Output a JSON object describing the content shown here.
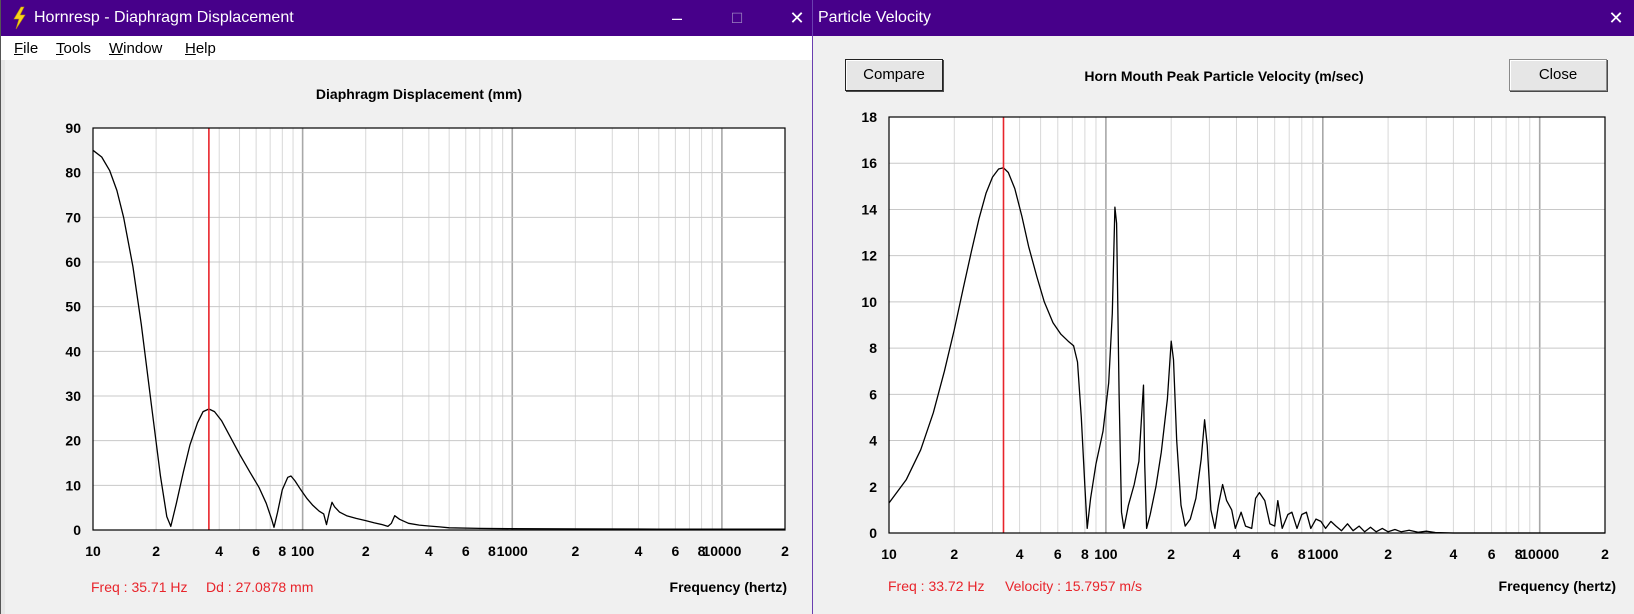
{
  "left_window": {
    "title": "Hornresp - Diaphragm Displacement",
    "icon": "lightning-bolt-icon",
    "menu": [
      {
        "label": "File",
        "accel": "F",
        "rest": "ile"
      },
      {
        "label": "Tools",
        "accel": "T",
        "rest": "ools"
      },
      {
        "label": "Window",
        "accel": "W",
        "rest": "indow"
      },
      {
        "label": "Help",
        "accel": "H",
        "rest": "elp"
      }
    ],
    "minimize_glyph": "–",
    "maximize_glyph": "☐",
    "close_glyph": "✕",
    "chart_title": "Diaphragm Displacement (mm)",
    "x_axis_label": "Frequency (hertz)",
    "readout_freq": "Freq : 35.71 Hz",
    "readout_value": "Dd : 27.0878 mm"
  },
  "right_window": {
    "title": "Particle Velocity",
    "close_glyph": "✕",
    "compare_button": "Compare",
    "close_button": "Close",
    "chart_title": "Horn Mouth Peak Particle Velocity (m/sec)",
    "x_axis_label": "Frequency (hertz)",
    "readout_freq": "Freq : 33.72 Hz",
    "readout_value": "Velocity : 15.7957 m/s"
  },
  "colors": {
    "titlebar": "#47008a",
    "marker": "#e8242b",
    "trace": "#000000",
    "grid": "#c8c8c8"
  },
  "chart_data": [
    {
      "type": "line",
      "title": "Diaphragm Displacement (mm)",
      "xlabel": "Frequency (hertz)",
      "ylabel": "",
      "x_scale": "log",
      "xlim": [
        10,
        20000
      ],
      "ylim": [
        0,
        90
      ],
      "y_ticks": [
        0,
        10,
        20,
        30,
        40,
        50,
        60,
        70,
        80,
        90
      ],
      "x_tick_labels": [
        {
          "f": 10,
          "t": "10"
        },
        {
          "f": 20,
          "t": "2"
        },
        {
          "f": 40,
          "t": "4"
        },
        {
          "f": 60,
          "t": "6"
        },
        {
          "f": 80,
          "t": "8"
        },
        {
          "f": 100,
          "t": "100"
        },
        {
          "f": 200,
          "t": "2"
        },
        {
          "f": 400,
          "t": "4"
        },
        {
          "f": 600,
          "t": "6"
        },
        {
          "f": 800,
          "t": "8"
        },
        {
          "f": 1000,
          "t": "1000"
        },
        {
          "f": 2000,
          "t": "2"
        },
        {
          "f": 4000,
          "t": "4"
        },
        {
          "f": 6000,
          "t": "6"
        },
        {
          "f": 8000,
          "t": "8"
        },
        {
          "f": 10000,
          "t": "10000"
        },
        {
          "f": 20000,
          "t": "2"
        }
      ],
      "marker_x": 35.71,
      "grid": true,
      "series": [
        {
          "points": [
            [
              10,
              85
            ],
            [
              11,
              83.5
            ],
            [
              12,
              80.5
            ],
            [
              13,
              76
            ],
            [
              14,
              70
            ],
            [
              15.5,
              59
            ],
            [
              17,
              46
            ],
            [
              19,
              28
            ],
            [
              21,
              12
            ],
            [
              22.5,
              3
            ],
            [
              23.5,
              0.8
            ],
            [
              25,
              6
            ],
            [
              27,
              13
            ],
            [
              29,
              19
            ],
            [
              31.5,
              24
            ],
            [
              33.5,
              26.5
            ],
            [
              35.71,
              27.09
            ],
            [
              38,
              26.5
            ],
            [
              41,
              24.5
            ],
            [
              45,
              21
            ],
            [
              50,
              17
            ],
            [
              56,
              13
            ],
            [
              62,
              9.5
            ],
            [
              67,
              6
            ],
            [
              71,
              2.5
            ],
            [
              73,
              0.6
            ],
            [
              76,
              4
            ],
            [
              80,
              9
            ],
            [
              85,
              11.8
            ],
            [
              88,
              12.1
            ],
            [
              92,
              11
            ],
            [
              98,
              9
            ],
            [
              105,
              7
            ],
            [
              112,
              5.5
            ],
            [
              120,
              4.2
            ],
            [
              126,
              3.6
            ],
            [
              130,
              1.2
            ],
            [
              134,
              4
            ],
            [
              138,
              6.2
            ],
            [
              142,
              5.2
            ],
            [
              150,
              4
            ],
            [
              162,
              3.2
            ],
            [
              180,
              2.6
            ],
            [
              200,
              2.1
            ],
            [
              220,
              1.6
            ],
            [
              240,
              1.2
            ],
            [
              255,
              0.8
            ],
            [
              265,
              1.5
            ],
            [
              275,
              3.2
            ],
            [
              290,
              2.4
            ],
            [
              320,
              1.5
            ],
            [
              360,
              1.1
            ],
            [
              400,
              0.9
            ],
            [
              450,
              0.7
            ],
            [
              500,
              0.5
            ],
            [
              700,
              0.35
            ],
            [
              1000,
              0.3
            ],
            [
              2000,
              0.25
            ],
            [
              5000,
              0.2
            ],
            [
              20000,
              0.2
            ]
          ]
        }
      ]
    },
    {
      "type": "line",
      "title": "Horn Mouth Peak Particle Velocity (m/sec)",
      "xlabel": "Frequency (hertz)",
      "ylabel": "",
      "x_scale": "log",
      "xlim": [
        10,
        20000
      ],
      "ylim": [
        0,
        18
      ],
      "y_ticks": [
        0,
        2,
        4,
        6,
        8,
        10,
        12,
        14,
        16,
        18
      ],
      "x_tick_labels": [
        {
          "f": 10,
          "t": "10"
        },
        {
          "f": 20,
          "t": "2"
        },
        {
          "f": 40,
          "t": "4"
        },
        {
          "f": 60,
          "t": "6"
        },
        {
          "f": 80,
          "t": "8"
        },
        {
          "f": 100,
          "t": "100"
        },
        {
          "f": 200,
          "t": "2"
        },
        {
          "f": 400,
          "t": "4"
        },
        {
          "f": 600,
          "t": "6"
        },
        {
          "f": 800,
          "t": "8"
        },
        {
          "f": 1000,
          "t": "1000"
        },
        {
          "f": 2000,
          "t": "2"
        },
        {
          "f": 4000,
          "t": "4"
        },
        {
          "f": 6000,
          "t": "6"
        },
        {
          "f": 8000,
          "t": "8"
        },
        {
          "f": 10000,
          "t": "10000"
        },
        {
          "f": 20000,
          "t": "2"
        }
      ],
      "marker_x": 33.72,
      "grid": true,
      "series": [
        {
          "points": [
            [
              10,
              1.3
            ],
            [
              12,
              2.3
            ],
            [
              14,
              3.6
            ],
            [
              16,
              5.2
            ],
            [
              18,
              7
            ],
            [
              20,
              8.8
            ],
            [
              22,
              10.6
            ],
            [
              24,
              12.2
            ],
            [
              26,
              13.6
            ],
            [
              28,
              14.7
            ],
            [
              30,
              15.4
            ],
            [
              32,
              15.75
            ],
            [
              33.72,
              15.8
            ],
            [
              35.5,
              15.6
            ],
            [
              38,
              14.9
            ],
            [
              41,
              13.7
            ],
            [
              44,
              12.4
            ],
            [
              48,
              11.1
            ],
            [
              52,
              10
            ],
            [
              57,
              9.1
            ],
            [
              62,
              8.6
            ],
            [
              67,
              8.3
            ],
            [
              71,
              8.1
            ],
            [
              74,
              7.4
            ],
            [
              77,
              5
            ],
            [
              80,
              2
            ],
            [
              82,
              0.2
            ],
            [
              85,
              1.5
            ],
            [
              90,
              3
            ],
            [
              97,
              4.4
            ],
            [
              103,
              6.5
            ],
            [
              107,
              9.5
            ],
            [
              110,
              14.1
            ],
            [
              112,
              13.4
            ],
            [
              115,
              6
            ],
            [
              118,
              0.9
            ],
            [
              121,
              0.2
            ],
            [
              127,
              1.2
            ],
            [
              135,
              2.1
            ],
            [
              142,
              3.1
            ],
            [
              147,
              5.5
            ],
            [
              149,
              6.4
            ],
            [
              151,
              3
            ],
            [
              154,
              0.2
            ],
            [
              160,
              0.8
            ],
            [
              170,
              2
            ],
            [
              180,
              3.5
            ],
            [
              192,
              5.8
            ],
            [
              200,
              8.3
            ],
            [
              205,
              7.5
            ],
            [
              212,
              4
            ],
            [
              222,
              1.2
            ],
            [
              232,
              0.3
            ],
            [
              245,
              0.6
            ],
            [
              260,
              1.5
            ],
            [
              275,
              3.2
            ],
            [
              285,
              4.9
            ],
            [
              293,
              3.8
            ],
            [
              305,
              1
            ],
            [
              318,
              0.2
            ],
            [
              330,
              1.2
            ],
            [
              345,
              2.1
            ],
            [
              360,
              1.4
            ],
            [
              380,
              1
            ],
            [
              395,
              0.2
            ],
            [
              420,
              0.9
            ],
            [
              440,
              0.3
            ],
            [
              470,
              0.2
            ],
            [
              490,
              1.5
            ],
            [
              510,
              1.75
            ],
            [
              540,
              1.4
            ],
            [
              570,
              0.4
            ],
            [
              600,
              0.3
            ],
            [
              620,
              1.4
            ],
            [
              650,
              0.2
            ],
            [
              690,
              0.8
            ],
            [
              720,
              0.9
            ],
            [
              760,
              0.2
            ],
            [
              800,
              0.8
            ],
            [
              840,
              0.9
            ],
            [
              880,
              0.2
            ],
            [
              930,
              0.6
            ],
            [
              980,
              0.5
            ],
            [
              1030,
              0.2
            ],
            [
              1090,
              0.5
            ],
            [
              1150,
              0.3
            ],
            [
              1220,
              0.1
            ],
            [
              1300,
              0.4
            ],
            [
              1380,
              0.1
            ],
            [
              1470,
              0.3
            ],
            [
              1560,
              0.05
            ],
            [
              1660,
              0.25
            ],
            [
              1760,
              0.05
            ],
            [
              1880,
              0.2
            ],
            [
              2000,
              0.05
            ],
            [
              2150,
              0.15
            ],
            [
              2300,
              0.05
            ],
            [
              2500,
              0.12
            ],
            [
              2750,
              0.03
            ],
            [
              3000,
              0.08
            ],
            [
              3300,
              0.02
            ],
            [
              4000,
              0
            ],
            [
              20000,
              0
            ]
          ]
        }
      ]
    }
  ]
}
